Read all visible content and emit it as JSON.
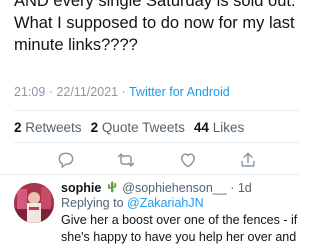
{
  "tweet": {
    "text_lines": [
      "AND every single Saturday is sold out.",
      "What I supposed to do now for my last",
      "minute links????"
    ],
    "time": "21:09",
    "separator": "·",
    "date": "22/11/2021",
    "source": "Twitter for Android"
  },
  "stats": {
    "retweets_count": "2",
    "retweets_label": "Retweets",
    "quote_count": "2",
    "quote_label": "Quote Tweets",
    "likes_count": "44",
    "likes_label": "Likes"
  },
  "actions": {
    "icons": [
      "reply-icon",
      "retweet-icon",
      "like-icon",
      "share-icon"
    ],
    "icon_color": "#8b98a5"
  },
  "reply": {
    "name": "sophie",
    "emoji": "cactus",
    "handle": "@sophiehenson__",
    "separator": "·",
    "age": "1d",
    "replying_label": "Replying to",
    "replying_to": "@ZakariahJN",
    "text_lines": [
      "Give her a boost over one of the fences - if",
      "she's happy to have you help her over and"
    ]
  },
  "colors": {
    "link": "#1d9bf0",
    "muted": "#536471",
    "divider": "#e6ecf0",
    "text": "#0f1419"
  }
}
